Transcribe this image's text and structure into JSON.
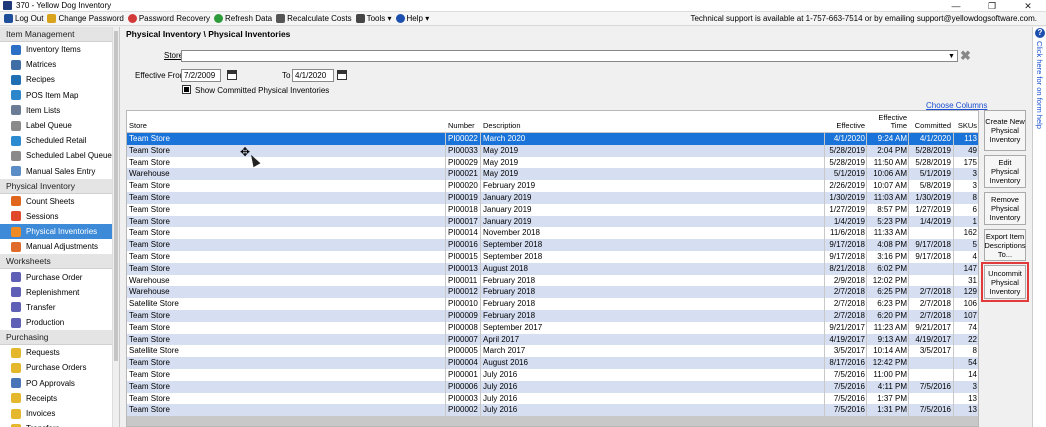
{
  "window": {
    "title": "370  - Yellow Dog Inventory",
    "minimize": "—",
    "maximize": "❐",
    "close": "✕"
  },
  "menubar": {
    "items": [
      "Log Out",
      "Change Password",
      "Password Recovery",
      "Refresh Data",
      "Recalculate Costs",
      "Tools ▾",
      "Help ▾"
    ],
    "support_text": "Technical support is available at 1-757-663-7514 or by emailing support@yellowdogsoftware.com."
  },
  "sidebar": {
    "sections": [
      {
        "title": "Item Management",
        "items": [
          {
            "label": "Inventory Items",
            "color": "#2c6fc4"
          },
          {
            "label": "Matrices",
            "color": "#3f6ea6"
          },
          {
            "label": "Recipes",
            "color": "#1f6fb5"
          },
          {
            "label": "POS Item Map",
            "color": "#2c86c9"
          },
          {
            "label": "Item Lists",
            "color": "#6b7d95"
          },
          {
            "label": "Label Queue",
            "color": "#8a8a8a"
          },
          {
            "label": "Scheduled Retail",
            "color": "#2c8ad1"
          },
          {
            "label": "Scheduled Label Queue",
            "color": "#8a8a8a"
          },
          {
            "label": "Manual Sales Entry",
            "color": "#5b8dc7"
          }
        ]
      },
      {
        "title": "Physical Inventory",
        "items": [
          {
            "label": "Count Sheets",
            "color": "#e0661e"
          },
          {
            "label": "Sessions",
            "color": "#e04a2a"
          },
          {
            "label": "Physical Inventories",
            "color": "#f08a24",
            "active": true
          },
          {
            "label": "Manual Adjustments",
            "color": "#e06a2a"
          }
        ]
      },
      {
        "title": "Worksheets",
        "items": [
          {
            "label": "Purchase Order",
            "color": "#5e5fb5"
          },
          {
            "label": "Replenishment",
            "color": "#5e5fb5"
          },
          {
            "label": "Transfer",
            "color": "#5e5fb5"
          },
          {
            "label": "Production",
            "color": "#5e5fb5"
          }
        ]
      },
      {
        "title": "Purchasing",
        "items": [
          {
            "label": "Requests",
            "color": "#e4b72c"
          },
          {
            "label": "Purchase Orders",
            "color": "#e4b72c"
          },
          {
            "label": "PO Approvals",
            "color": "#4a74b8"
          },
          {
            "label": "Receipts",
            "color": "#e4b72c"
          },
          {
            "label": "Invoices",
            "color": "#e4b72c"
          },
          {
            "label": "Transfers",
            "color": "#e4b72c"
          }
        ]
      }
    ]
  },
  "breadcrumb": "Physical Inventory \\ Physical Inventories",
  "filters": {
    "store_label": "Store",
    "store_value": "",
    "effective_from_label": "Effective From",
    "effective_from": "7/2/2009",
    "to_label": "To",
    "to_value": "4/1/2020",
    "show_committed_label": "Show Committed Physical Inventories",
    "show_committed": true
  },
  "choose_columns": "Choose Columns",
  "grid": {
    "headers": {
      "store": "Store",
      "number": "Number",
      "description": "Description",
      "effective": "Effective",
      "effective_time": "Effective Time",
      "committed": "Committed",
      "skus": "SKUs"
    },
    "rows": [
      [
        "Team Store",
        "PI00022",
        "March 2020",
        "4/1/2020",
        "9:24 AM",
        "4/1/2020",
        "113"
      ],
      [
        "Team Store",
        "PI00033",
        "May 2019",
        "5/28/2019",
        "2:04 PM",
        "5/28/2019",
        "49"
      ],
      [
        "Team Store",
        "PI00029",
        "May 2019",
        "5/28/2019",
        "11:50 AM",
        "5/28/2019",
        "175"
      ],
      [
        "Warehouse",
        "PI00021",
        "May 2019",
        "5/1/2019",
        "10:06 AM",
        "5/1/2019",
        "3"
      ],
      [
        "Team Store",
        "PI00020",
        "February 2019",
        "2/26/2019",
        "10:07 AM",
        "5/8/2019",
        "3"
      ],
      [
        "Team Store",
        "PI00019",
        "January 2019",
        "1/30/2019",
        "11:03 AM",
        "1/30/2019",
        "8"
      ],
      [
        "Team Store",
        "PI00018",
        "January 2019",
        "1/27/2019",
        "8:57 PM",
        "1/27/2019",
        "6"
      ],
      [
        "Team Store",
        "PI00017",
        "January 2019",
        "1/4/2019",
        "5:23 PM",
        "1/4/2019",
        "1"
      ],
      [
        "Team Store",
        "PI00014",
        "November 2018",
        "11/6/2018",
        "11:33 AM",
        "",
        "162"
      ],
      [
        "Team Store",
        "PI00016",
        "September 2018",
        "9/17/2018",
        "4:08 PM",
        "9/17/2018",
        "5"
      ],
      [
        "Team Store",
        "PI00015",
        "September 2018",
        "9/17/2018",
        "3:16 PM",
        "9/17/2018",
        "4"
      ],
      [
        "Team Store",
        "PI00013",
        "August 2018",
        "8/21/2018",
        "6:02 PM",
        "",
        "147"
      ],
      [
        "Warehouse",
        "PI00011",
        "February 2018",
        "2/9/2018",
        "12:02 PM",
        "",
        "31"
      ],
      [
        "Warehouse",
        "PI00012",
        "February 2018",
        "2/7/2018",
        "6:25 PM",
        "2/7/2018",
        "129"
      ],
      [
        "Satellite Store",
        "PI00010",
        "February 2018",
        "2/7/2018",
        "6:23 PM",
        "2/7/2018",
        "106"
      ],
      [
        "Team Store",
        "PI00009",
        "February 2018",
        "2/7/2018",
        "6:20 PM",
        "2/7/2018",
        "107"
      ],
      [
        "Team Store",
        "PI00008",
        "September 2017",
        "9/21/2017",
        "11:23 AM",
        "9/21/2017",
        "74"
      ],
      [
        "Team Store",
        "PI00007",
        "April 2017",
        "4/19/2017",
        "9:13 AM",
        "4/19/2017",
        "22"
      ],
      [
        "Satellite Store",
        "PI00005",
        "March 2017",
        "3/5/2017",
        "10:14 AM",
        "3/5/2017",
        "8"
      ],
      [
        "Team Store",
        "PI00004",
        "August 2016",
        "8/17/2016",
        "12:42 PM",
        "",
        "54"
      ],
      [
        "Team Store",
        "PI00001",
        "July 2016",
        "7/5/2016",
        "11:00 PM",
        "",
        "14"
      ],
      [
        "Team Store",
        "PI00006",
        "July 2016",
        "7/5/2016",
        "4:11 PM",
        "7/5/2016",
        "3"
      ],
      [
        "Team Store",
        "PI00003",
        "July 2016",
        "7/5/2016",
        "1:37 PM",
        "",
        "13"
      ],
      [
        "Team Store",
        "PI00002",
        "July 2016",
        "7/5/2016",
        "1:31 PM",
        "7/5/2016",
        "13"
      ]
    ]
  },
  "actions": {
    "create": "Create New Physical Inventory",
    "edit": "Edit Physical Inventory",
    "remove": "Remove Physical Inventory",
    "export": "Export Item Descriptions To...",
    "uncommit": "Uncommit Physical Inventory"
  },
  "help": {
    "icon": "?",
    "text": "Click here for on form help"
  }
}
